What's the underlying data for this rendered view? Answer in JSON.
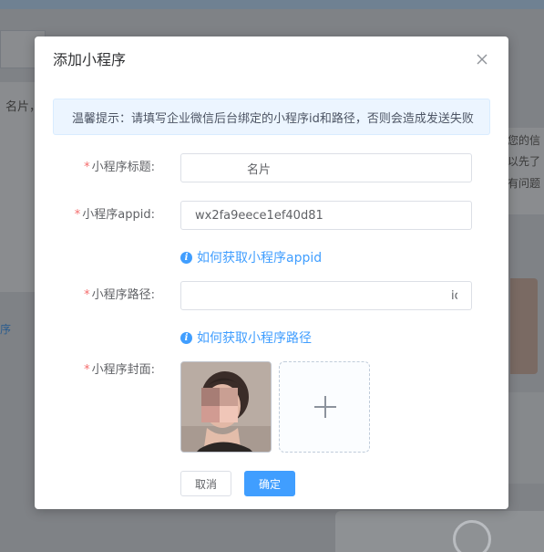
{
  "background": {
    "left_text": "名片，您",
    "left_link": "序",
    "right_lines": [
      "您的信",
      "以先了",
      "有问题"
    ]
  },
  "dialog": {
    "title": "添加小程序",
    "close_icon": "close-icon",
    "alert_text": "温馨提示：请填写企业微信后台绑定的小程序id和路径，否则会造成发送失败"
  },
  "form": {
    "title_label": "小程序标题:",
    "title_value": "名片",
    "appid_label": "小程序appid:",
    "appid_value": "wx2fa9eece1ef40d81",
    "appid_help": "如何获取小程序appid",
    "path_label": "小程序路径:",
    "path_value": "ic",
    "path_help": "如何获取小程序路径",
    "cover_label": "小程序封面:",
    "required_mark": "*"
  },
  "buttons": {
    "cancel": "取消",
    "confirm": "确定"
  },
  "colors": {
    "primary": "#409eff",
    "required": "#f56c6c",
    "alert_bg": "#ecf5ff"
  }
}
